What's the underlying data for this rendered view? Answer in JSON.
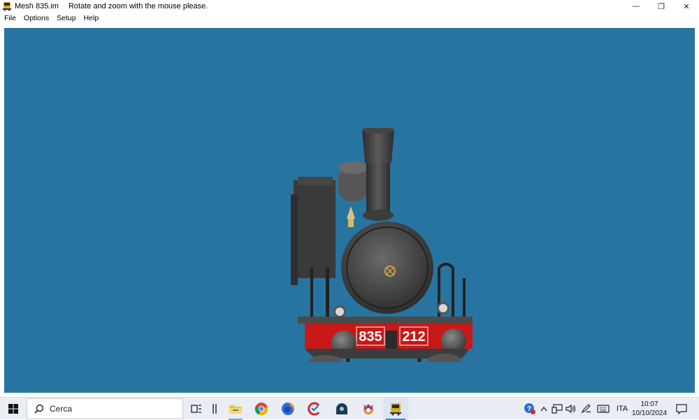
{
  "window": {
    "title": "Mesh 835.im",
    "hint": "Rotate and zoom with the mouse please.",
    "controls": {
      "minimize": "—",
      "restore": "❐",
      "close": "✕"
    }
  },
  "menu": {
    "items": [
      "File",
      "Options",
      "Setup",
      "Help"
    ]
  },
  "viewport": {
    "background": "#2874a0",
    "locomotive": {
      "number_left": "835",
      "number_right": "212",
      "buffer_beam_color": "#c81818",
      "body_color": "#3c3c3c"
    }
  },
  "taskbar": {
    "search_placeholder": "Cerca",
    "apps": [
      "task-view-icon",
      "widgets-icon",
      "file-explorer-icon",
      "chrome-icon",
      "firefox-icon",
      "ccleaner-icon",
      "app-dome-icon",
      "app-badge-icon",
      "mesh-viewer-icon"
    ],
    "tray": {
      "language": "ITA",
      "time": "10:07",
      "date": "10/10/2024"
    }
  }
}
